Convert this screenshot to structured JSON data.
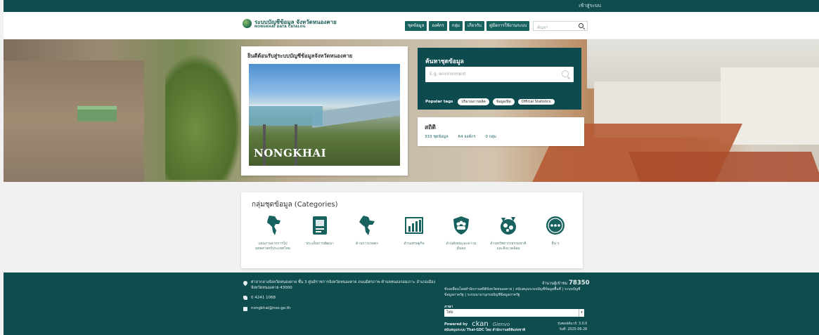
{
  "topbar": {
    "login": "เข้าสู่ระบบ"
  },
  "header": {
    "logo_title": "ระบบบัญชีข้อมูล จังหวัดหนองคาย",
    "logo_sub": "NONGKHAI DATA CATALOG",
    "nav": [
      "ชุดข้อมูล",
      "องค์กร",
      "กลุ่ม",
      "เกี่ยวกับ",
      "คู่มือการใช้งานระบบ"
    ],
    "search_placeholder": "ค้นหา"
  },
  "welcome": {
    "title": "ยินดีต้อนรับสู่ระบบบัญชีข้อมูลจังหวัดหนองคาย",
    "caption": "NONGKHAI"
  },
  "search_card": {
    "title": "ค้นหาชุดข้อมูล",
    "placeholder": "E.g. environment",
    "popular_label": "Popular tags",
    "tags": [
      "ปริมาณการผลิต",
      "ข้อมูลเปิด",
      "Official Statistics"
    ]
  },
  "stats": {
    "title": "สถิติ",
    "datasets": "333 ชุดข้อมูล",
    "orgs": "64 องค์กร",
    "groups": "0 กลุ่ม"
  },
  "categories": {
    "title": "กลุ่มชุดข้อมูล (Categories)",
    "items": [
      {
        "icon": "thailand-map-icon",
        "label1": "แผนงานจากการไป",
        "label2": "ยุทธศาสตร์ประเทศไทย"
      },
      {
        "icon": "document-icon",
        "label1": "ประเด็นการพัฒนา",
        "label2": ""
      },
      {
        "icon": "region-map-icon",
        "label1": "ด้านการเกษตร",
        "label2": ""
      },
      {
        "icon": "bar-chart-icon",
        "label1": "ด้านเศรษฐกิจ",
        "label2": ""
      },
      {
        "icon": "shield-people-icon",
        "label1": "ด้านสังคมและความ",
        "label2": "มั่นคง"
      },
      {
        "icon": "environment-icon",
        "label1": "ด้านทรัพยากรธรรมชาติ",
        "label2": "และสิ่งแวดล้อม"
      },
      {
        "icon": "more-icon",
        "label1": "อื่น ๆ",
        "label2": ""
      }
    ]
  },
  "footer": {
    "address1": "ศาลากลางจังหวัดหนองคาย ชั้น 3 ศูนย์ราชการจังหวัดหนองคาย ถนนมิตรภาพ ตำบลหนองกอมเกาะ อำเภอเมือง",
    "address2": "จังหวัดหนองคาย 43000",
    "phone": "0 4241 1068",
    "email": "nongkhai@nso.go.th",
    "visitors_label": "จำนวนผู้เข้าชม",
    "visitors": "78350",
    "links1": "ขับเคลื่อนโดยสำนักงานสถิติจังหวัดหนองคาย | สนับสนุนระบบบัญชีข้อมูลพื้นที่ | ระบบบัญชี",
    "links2": "ข้อมูลภาครัฐ | ระบบนามานุกรมบัญชีข้อมูลภาครัฐ",
    "lang_label": "ภาษา",
    "lang_value": "ไทย",
    "powered_label": "Powered by",
    "ckan": "ckan",
    "gen": "Gienvo",
    "supported": "สนับสนุนระบบ Thai-GDC โดย สำนักงานสถิติแห่งชาติ",
    "version": "รุ่นซอฟต์แวร์: 3.0.0",
    "date": "วันที่: 2025-06-26"
  }
}
